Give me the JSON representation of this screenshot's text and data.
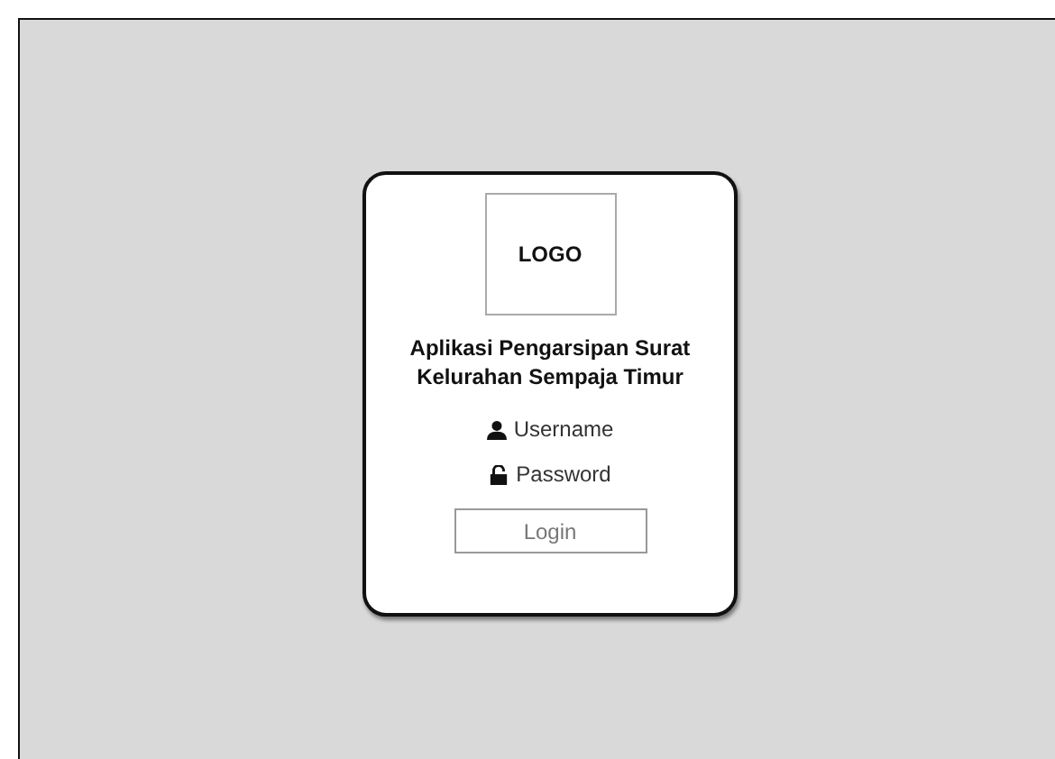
{
  "login_card": {
    "logo": "LOGO",
    "title": "Aplikasi Pengarsipan Surat Kelurahan Sempaja Timur",
    "fields": [
      {
        "kind": "user",
        "label": "Username"
      },
      {
        "kind": "lock",
        "label": "Password"
      }
    ],
    "button": "Login"
  }
}
